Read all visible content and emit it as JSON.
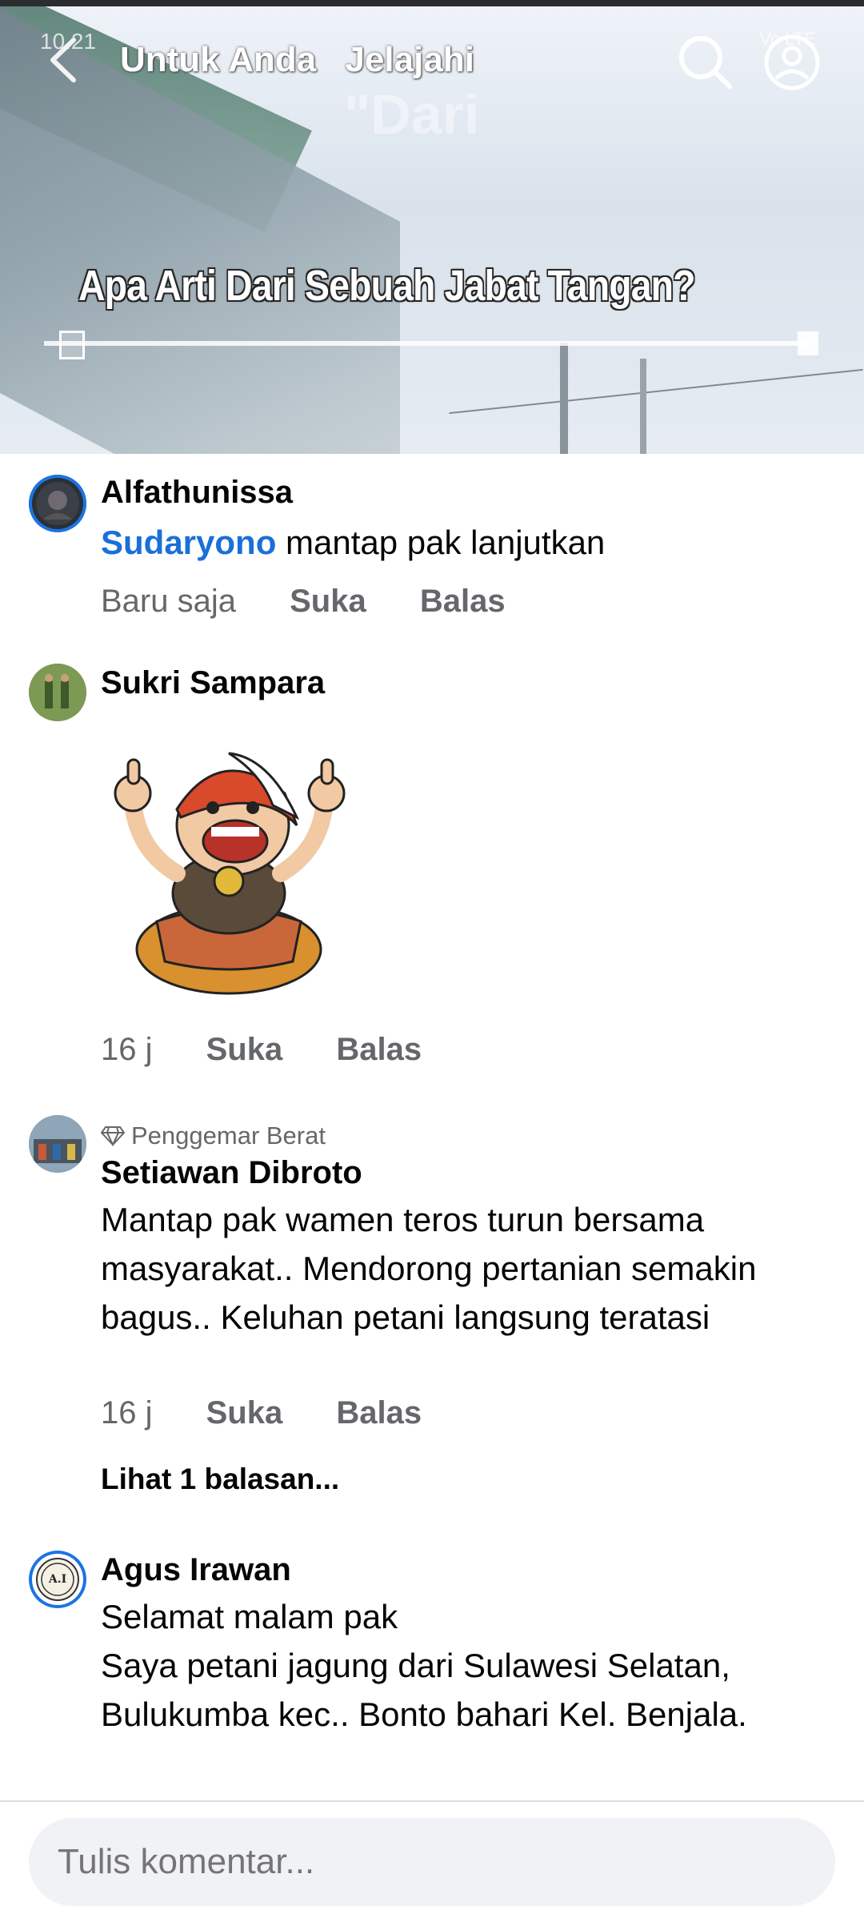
{
  "status_bar": {
    "time": "10.21",
    "icons": "Vo LTE"
  },
  "header": {
    "tabs": [
      "Untuk Anda",
      "Jelajahi"
    ],
    "back_icon": "chevron-left-icon",
    "search_icon": "search-icon",
    "profile_icon": "user-circle-icon"
  },
  "video": {
    "overlay_word": "\"Dari",
    "caption": "Apa Arti Dari Sebuah Jabat Tangan?",
    "progress": 0.02
  },
  "comments": [
    {
      "name": "Alfathunissa",
      "mention": "Sudaryono",
      "text": " mantap pak lanjutkan",
      "time": "Baru saja",
      "like": "Suka",
      "reply": "Balas"
    },
    {
      "name": "Sukri Sampara",
      "sticker": "thumbs-up-cartoon-sticker",
      "time": "16 j",
      "like": "Suka",
      "reply": "Balas"
    },
    {
      "badge": "Penggemar Berat",
      "name": "Setiawan Dibroto",
      "text": "Mantap pak wamen teros turun bersama masyarakat.. Mendorong pertanian semakin bagus.. Keluhan petani langsung teratasi",
      "time": "16 j",
      "like": "Suka",
      "reply": "Balas",
      "view_replies": "Lihat 1 balasan..."
    },
    {
      "name": "Agus Irawan",
      "avatar_text": "A.I",
      "text_line1": "Selamat malam pak",
      "text_line2": "Saya petani jagung dari Sulawesi Selatan, Bulukumba kec.. Bonto bahari Kel. Benjala."
    }
  ],
  "composer": {
    "placeholder": "Tulis komentar..."
  },
  "colors": {
    "link": "#1b6fd8",
    "meta": "#65676b",
    "input_bg": "#f0f2f5"
  }
}
